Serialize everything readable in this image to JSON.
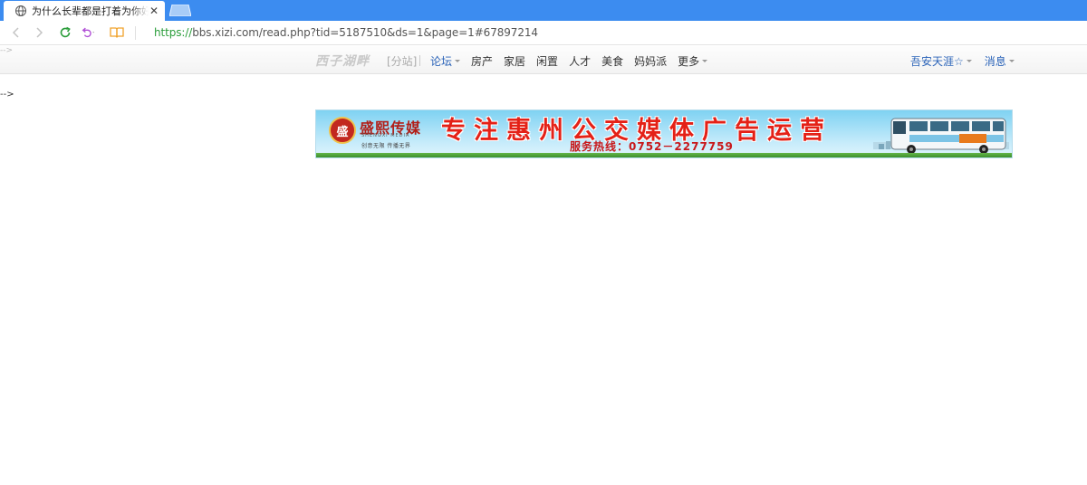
{
  "browser": {
    "tab_title": "为什么长辈都是打着为你好的旗号",
    "tab_close": "✕",
    "url_scheme": "https://",
    "url_rest": "bbs.xizi.com/read.php?tid=5187510&ds=1&page=1#67897214"
  },
  "site": {
    "top_comment": "-->",
    "logo": "西子湖畔",
    "branch": "[分站]",
    "menu": [
      {
        "label": "论坛",
        "dropdown": true,
        "accent": true
      },
      {
        "label": "房产",
        "dropdown": false,
        "accent": false
      },
      {
        "label": "家居",
        "dropdown": false,
        "accent": false
      },
      {
        "label": "闲置",
        "dropdown": false,
        "accent": false
      },
      {
        "label": "人才",
        "dropdown": false,
        "accent": false
      },
      {
        "label": "美食",
        "dropdown": false,
        "accent": false
      },
      {
        "label": "妈妈派",
        "dropdown": false,
        "accent": false
      },
      {
        "label": "更多",
        "dropdown": true,
        "accent": false
      }
    ],
    "user_name": "吾安天涯☆",
    "messages": "消息",
    "body_comment": "-->"
  },
  "banner": {
    "logo_glyph": "盛",
    "brand": "盛熙传媒",
    "brand_en": "SHENGXI MEDIA",
    "tagline": "创意无限  传播无界",
    "headline": "专注惠州公交媒体广告运营",
    "hotline": "服务热线：0752－2277759",
    "colors": {
      "headline": "#e42117",
      "brand": "#b1201a"
    }
  }
}
